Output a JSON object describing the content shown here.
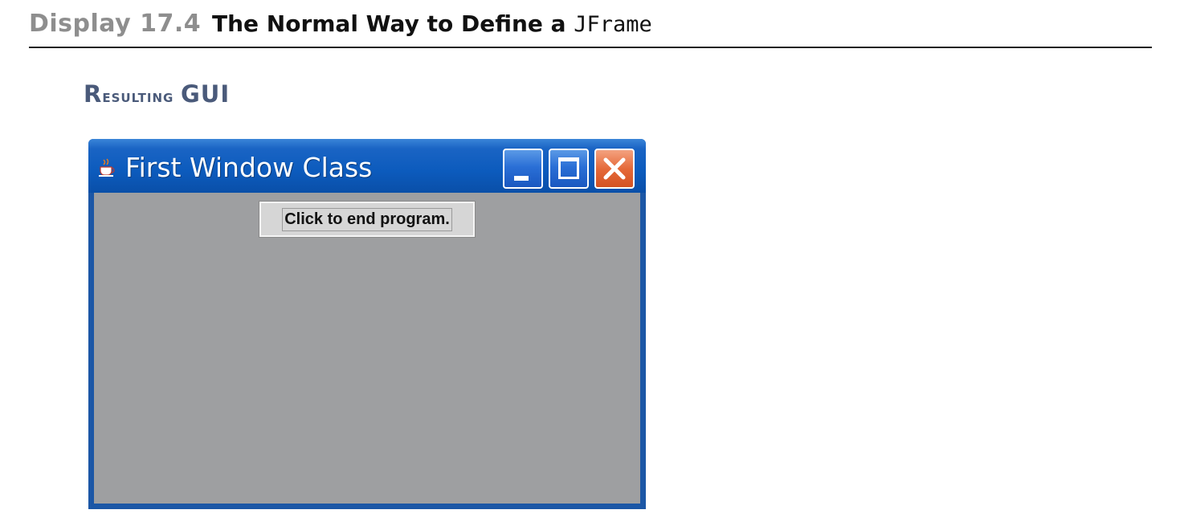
{
  "header": {
    "display_label": "Display 17.4",
    "title_text": "The Normal Way to Define a ",
    "title_code": "JFrame"
  },
  "section": {
    "heading_first": "R",
    "heading_rest": "esulting ",
    "heading_gui": "GUI"
  },
  "window": {
    "title": "First Window Class",
    "icon": "java-cup-icon",
    "controls": {
      "minimize_icon": "minimize-icon",
      "maximize_icon": "maximize-icon",
      "close_icon": "close-icon"
    },
    "button_label": "Click to end program.",
    "colors": {
      "titlebar": "#0c5bbd",
      "content_background": "#9e9fa1",
      "close_button": "#e56a3a",
      "section_heading": "#4a5a7a",
      "display_label": "#8e8e8e"
    }
  }
}
